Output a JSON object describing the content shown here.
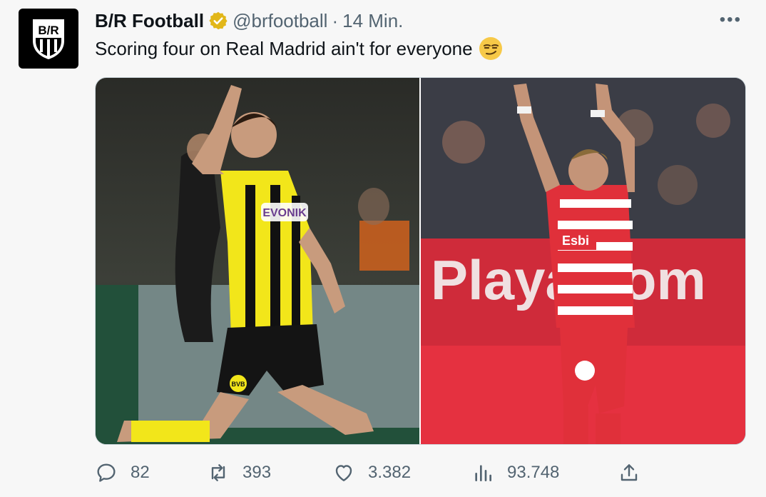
{
  "tweet": {
    "account_name": "B/R Football",
    "handle": "@brfootball",
    "separator": "·",
    "time": "14 Min.",
    "text": "Scoring four on Real Madrid ain't for everyone",
    "avatar_text": "B/R",
    "more_label": "•••"
  },
  "media": {
    "left_photo": {
      "shirt_sponsor": "EVONIK",
      "crest": "BVB"
    },
    "right_photo": {
      "shirt_sponsor": "Esbi",
      "background_ad": "Playa.com"
    }
  },
  "actions": {
    "replies": "82",
    "reposts": "393",
    "likes": "3.382",
    "views": "93.748"
  },
  "colors": {
    "text": "#0f1419",
    "secondary": "#536471",
    "verified_gold": "#e2b719",
    "background": "#f7f7f7"
  },
  "icons": [
    "verified-badge-icon",
    "smirk-emoji-icon",
    "more-icon",
    "reply-icon",
    "repost-icon",
    "like-icon",
    "views-icon",
    "share-icon"
  ]
}
